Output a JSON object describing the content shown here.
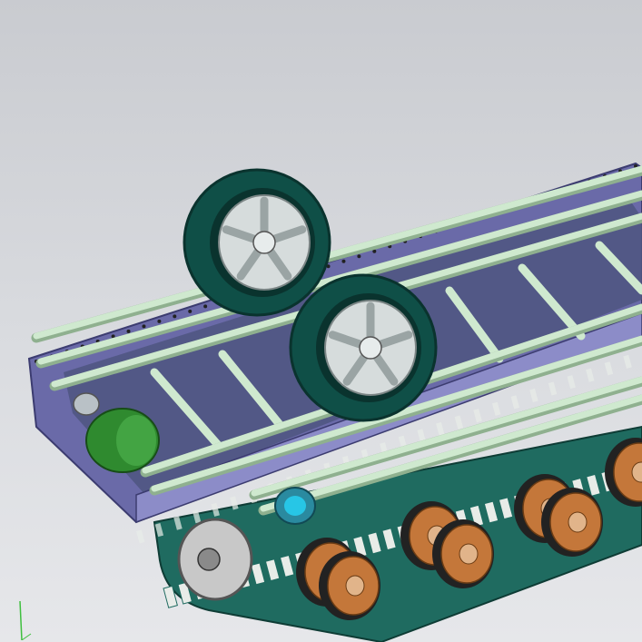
{
  "viewport": {
    "background_top": "#c9cbd0",
    "background_bottom": "#e6e7ea"
  },
  "model": {
    "part_colors": {
      "frame": "#5c5c9e",
      "frame_light": "#8c8cc8",
      "tube": "#cfe9cf",
      "tube_shadow": "#8fb08f",
      "tire": "#0f4f47",
      "tire_edge": "#0a332e",
      "rim": "#d6dcdc",
      "road_wheel": "#c4773a",
      "road_wheel_hub": "#e1b48a",
      "track_link": "#1f6b60",
      "drive_gear": "#2f8a2f",
      "pulley_cyan": "#27c6e6",
      "sprocket": "#c8c8c8"
    }
  },
  "triad": {
    "colors": [
      "#3fbf3f",
      "#3fbf3f"
    ]
  }
}
